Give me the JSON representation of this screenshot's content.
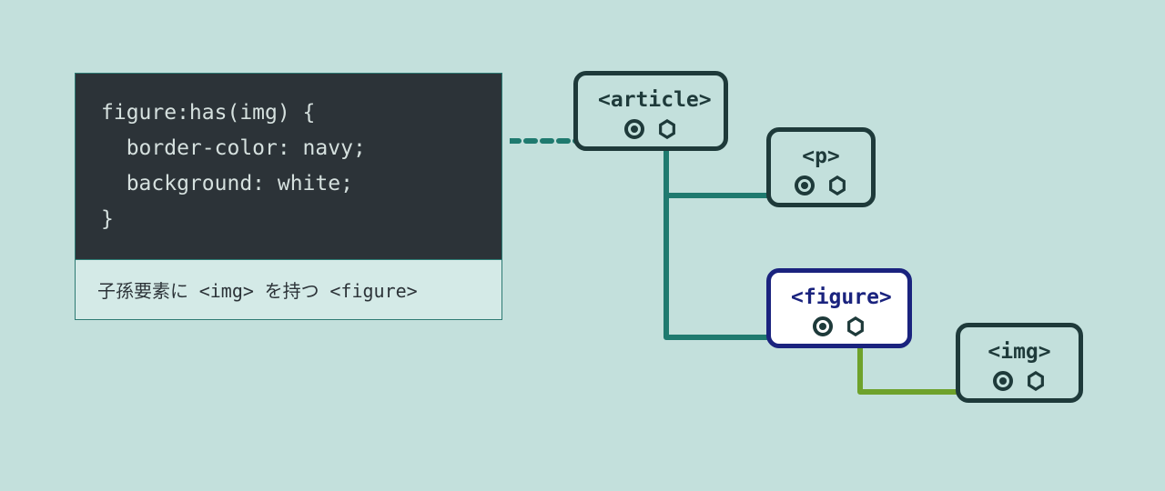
{
  "code": {
    "selector": "figure:has(img) {",
    "prop1": "  border-color: navy;",
    "prop2": "  background: white;",
    "close": "}"
  },
  "caption": {
    "prefix": "子孫要素に ",
    "tag1": "<img>",
    "mid": " を持つ ",
    "tag2": "<figure>"
  },
  "nodes": {
    "article": "<article>",
    "p": "<p>",
    "figure": "<figure>",
    "img": "<img>"
  }
}
